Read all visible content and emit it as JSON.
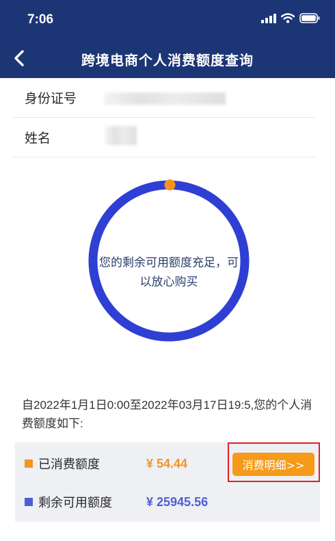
{
  "status_bar": {
    "time": "7:06"
  },
  "nav": {
    "title": "跨境电商个人消费额度查询"
  },
  "info": {
    "id_label": "身份证号",
    "name_label": "姓名"
  },
  "ring": {
    "message": "您的剩余可用额度充足，可以放心购买",
    "used_fraction": 0.0021,
    "remaining_color": "#2f3fd3",
    "used_color": "#f7931e"
  },
  "range_text": "自2022年1月1日0:00至2022年03月17日19:5,您的个人消费额度如下:",
  "summary": {
    "used_label": "已消费额度",
    "used_value": "¥ 54.44",
    "used_color": "#f7931e",
    "remaining_label": "剩余可用额度",
    "remaining_value": "¥ 25945.56",
    "remaining_color": "#4c5fd6",
    "detail_button": "消费明细>>"
  },
  "icons": [
    "signal-icon",
    "wifi-icon",
    "battery-icon",
    "back-chevron-icon"
  ]
}
